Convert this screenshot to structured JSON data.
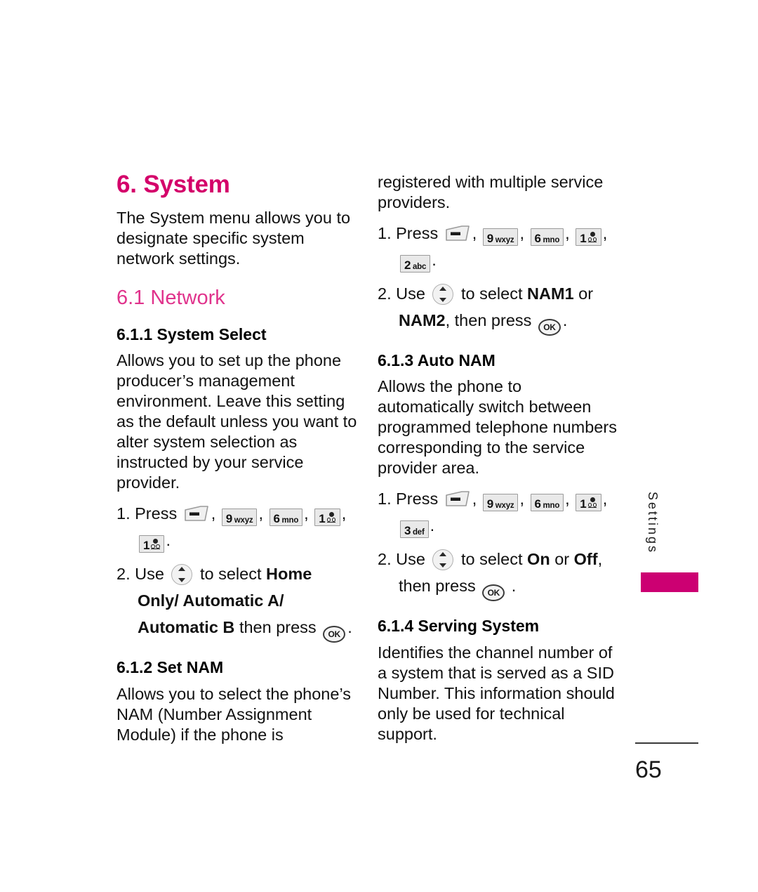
{
  "document": {
    "chapter_heading": "6. System",
    "chapter_intro": "The System menu allows you to designate specific system network settings.",
    "section_heading": "6.1 Network",
    "page_number": "65",
    "side_tab_label": "Settings",
    "accent_color": "#D4006A",
    "section_color": "#E0338C",
    "tab_color": "#CC0072"
  },
  "left_column": {
    "sub_1": {
      "heading": "6.1.1 System Select",
      "body": "Allows you to set up the phone producer’s management environment. Leave this setting as the default unless you want to alter system selection as instructed by your service provider.",
      "step1_prefix": "1. Press",
      "step1_keys": [
        "soft-menu-key",
        "9 wxyz",
        "6 mno",
        "1 voicemail",
        "1 voicemail"
      ],
      "step1_suffix": ".",
      "step2_prefix": "2. Use",
      "step2_mid": "to select",
      "step2_options_line1": "Home",
      "step2_options_line2": "Only/ Automatic A/",
      "step2_options_line3": "Automatic B",
      "step2_tail": "then press",
      "step2_suffix": "."
    },
    "sub_2": {
      "heading": "6.1.2 Set NAM",
      "body": "Allows you to select the phone’s NAM (Number Assignment Module) if the phone is"
    }
  },
  "right_column": {
    "continued_body": "registered with multiple service providers.",
    "sub_2_steps": {
      "step1_prefix": "1. Press",
      "step1_keys": [
        "soft-menu-key",
        "9 wxyz",
        "6 mno",
        "1 voicemail",
        "2 abc"
      ],
      "step1_suffix": ".",
      "step2_prefix": "2. Use",
      "step2_mid": "to select",
      "step2_option_a": "NAM1",
      "step2_or": "or",
      "step2_option_b": "NAM2",
      "step2_tail": ", then press",
      "step2_suffix": "."
    },
    "sub_3": {
      "heading": "6.1.3 Auto NAM",
      "body": "Allows the phone to automatically switch between programmed telephone numbers corresponding to the service provider area.",
      "step1_prefix": "1. Press",
      "step1_keys": [
        "soft-menu-key",
        "9 wxyz",
        "6 mno",
        "1 voicemail",
        "3 def"
      ],
      "step1_suffix": ".",
      "step2_prefix": "2. Use",
      "step2_mid": "to select",
      "step2_option_a": "On",
      "step2_or": "or",
      "step2_option_b": "Off",
      "step2_comma": ",",
      "step2_tail": "then press",
      "step2_suffix": "."
    },
    "sub_4": {
      "heading": "6.1.4 Serving System",
      "body": "Identifies the channel number of a system that is served as a SID Number. This information should only be used for technical support."
    }
  },
  "keys": {
    "k9": {
      "digit": "9",
      "letters": "wxyz"
    },
    "k6": {
      "digit": "6",
      "letters": "mno"
    },
    "k1": {
      "digit": "1",
      "letters": ""
    },
    "k2": {
      "digit": "2",
      "letters": "abc"
    },
    "k3": {
      "digit": "3",
      "letters": "def"
    },
    "ok": {
      "label": "OK"
    }
  }
}
